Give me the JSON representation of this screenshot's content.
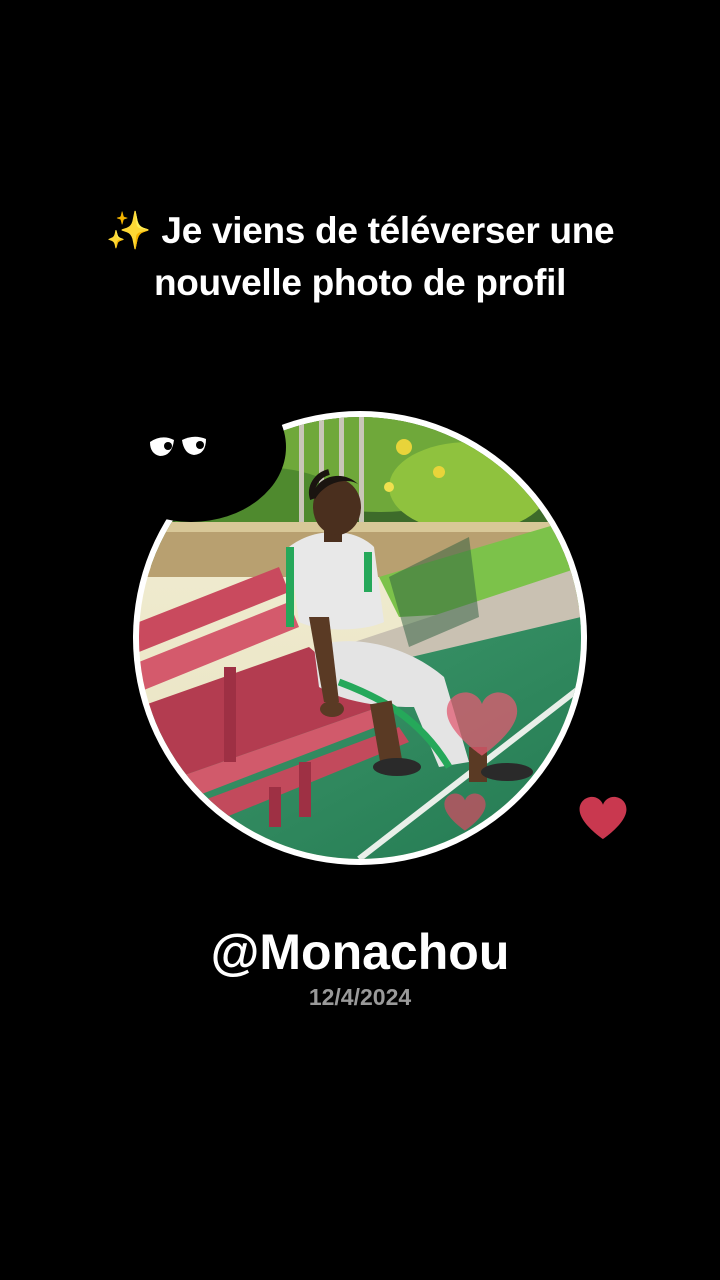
{
  "headline": {
    "sparkle": "✨",
    "text": "Je viens de téléverser une nouvelle photo de profil"
  },
  "profile": {
    "username": "@Monachou",
    "date": "12/4/2024"
  },
  "colors": {
    "background": "#000000",
    "text": "#ffffff",
    "date_text": "#9a9a9a",
    "ring": "#ffffff",
    "heart": "#c9384f",
    "sparkle": "#f7c948"
  },
  "icons": {
    "sticker_eyes": "eyes-icon",
    "hearts": [
      "heart-icon",
      "heart-icon",
      "heart-icon"
    ]
  }
}
